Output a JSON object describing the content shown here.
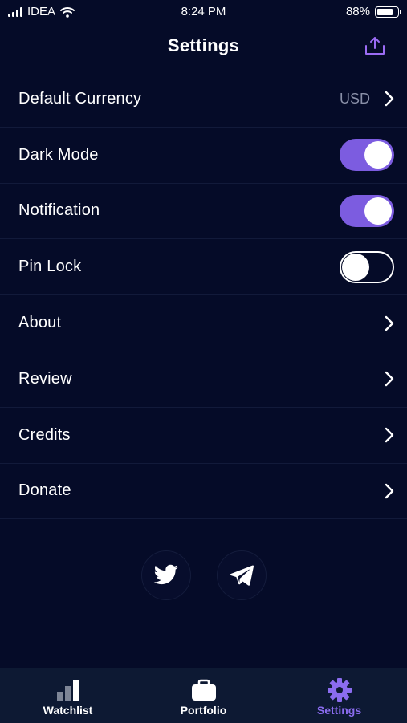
{
  "status_bar": {
    "carrier": "IDEA",
    "time": "8:24 PM",
    "battery_text": "88%",
    "battery_level": 0.88
  },
  "nav": {
    "title": "Settings",
    "share_icon": "share-icon"
  },
  "colors": {
    "background": "#050b28",
    "accent": "#7c5ce0",
    "tab_bar": "#0d1933",
    "muted": "#8a90a8"
  },
  "settings": {
    "default_currency": {
      "label": "Default Currency",
      "value": "USD"
    },
    "dark_mode": {
      "label": "Dark Mode",
      "enabled": true
    },
    "notification": {
      "label": "Notification",
      "enabled": true
    },
    "pin_lock": {
      "label": "Pin Lock",
      "enabled": false
    },
    "about": {
      "label": "About"
    },
    "review": {
      "label": "Review"
    },
    "credits": {
      "label": "Credits"
    },
    "donate": {
      "label": "Donate"
    }
  },
  "social": {
    "icons": [
      "twitter-icon",
      "telegram-icon"
    ]
  },
  "tabs": [
    {
      "label": "Watchlist",
      "icon": "bar-chart-icon",
      "active": false
    },
    {
      "label": "Portfolio",
      "icon": "briefcase-icon",
      "active": false
    },
    {
      "label": "Settings",
      "icon": "gear-icon",
      "active": true
    }
  ]
}
